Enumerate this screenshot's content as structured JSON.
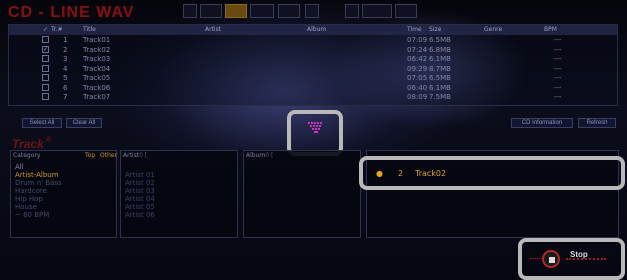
{
  "app": {
    "logo": "CD - LINE WAV"
  },
  "cd_table": {
    "headers": [
      "Tr.#",
      "Title",
      "Artist",
      "Album",
      "Time",
      "Size",
      "Genre",
      "BPM"
    ],
    "rows": [
      {
        "checked": false,
        "num": "1",
        "title": "Track01",
        "time": "07:09",
        "size": "6.5MB",
        "bpm": "---"
      },
      {
        "checked": true,
        "num": "2",
        "title": "Track02",
        "time": "07:24",
        "size": "6.8MB",
        "bpm": "---"
      },
      {
        "checked": false,
        "num": "3",
        "title": "Track03",
        "time": "06:42",
        "size": "6.1MB",
        "bpm": "---"
      },
      {
        "checked": false,
        "num": "4",
        "title": "Track04",
        "time": "09:29",
        "size": "8.7MB",
        "bpm": "---"
      },
      {
        "checked": false,
        "num": "5",
        "title": "Track05",
        "time": "07:05",
        "size": "6.5MB",
        "bpm": "---"
      },
      {
        "checked": false,
        "num": "6",
        "title": "Track06",
        "time": "06:40",
        "size": "6.1MB",
        "bpm": "---"
      },
      {
        "checked": false,
        "num": "7",
        "title": "Track07",
        "time": "08:09",
        "size": "7.5MB",
        "bpm": "---"
      }
    ]
  },
  "buttons": {
    "select_all": "Select All",
    "clear_all": "Clear All",
    "cd_information": "CD Information",
    "refresh": "Refresh"
  },
  "track_section": {
    "title": "Track",
    "category_header": "Category",
    "category_top": "Top",
    "category_other": "Other",
    "artist_header": "Artist",
    "album_header": "Album",
    "categories": [
      "All",
      "Artist-Album",
      "Drum n' Bass",
      "Hardcore",
      "Hip Hop",
      "House",
      "~ 60 BPM"
    ],
    "selected_category": "Artist-Album",
    "artists": [
      "Artist 01",
      "Artist 02",
      "Artist 03",
      "Artist 04",
      "Artist 05",
      "Artist 06"
    ]
  },
  "now_row": {
    "number": "2",
    "title": "Track02"
  },
  "stop": {
    "label": "Stop"
  },
  "colors": {
    "accent": "#e0a428",
    "logo": "#7a1518",
    "highlight": "#b9b9b9"
  }
}
